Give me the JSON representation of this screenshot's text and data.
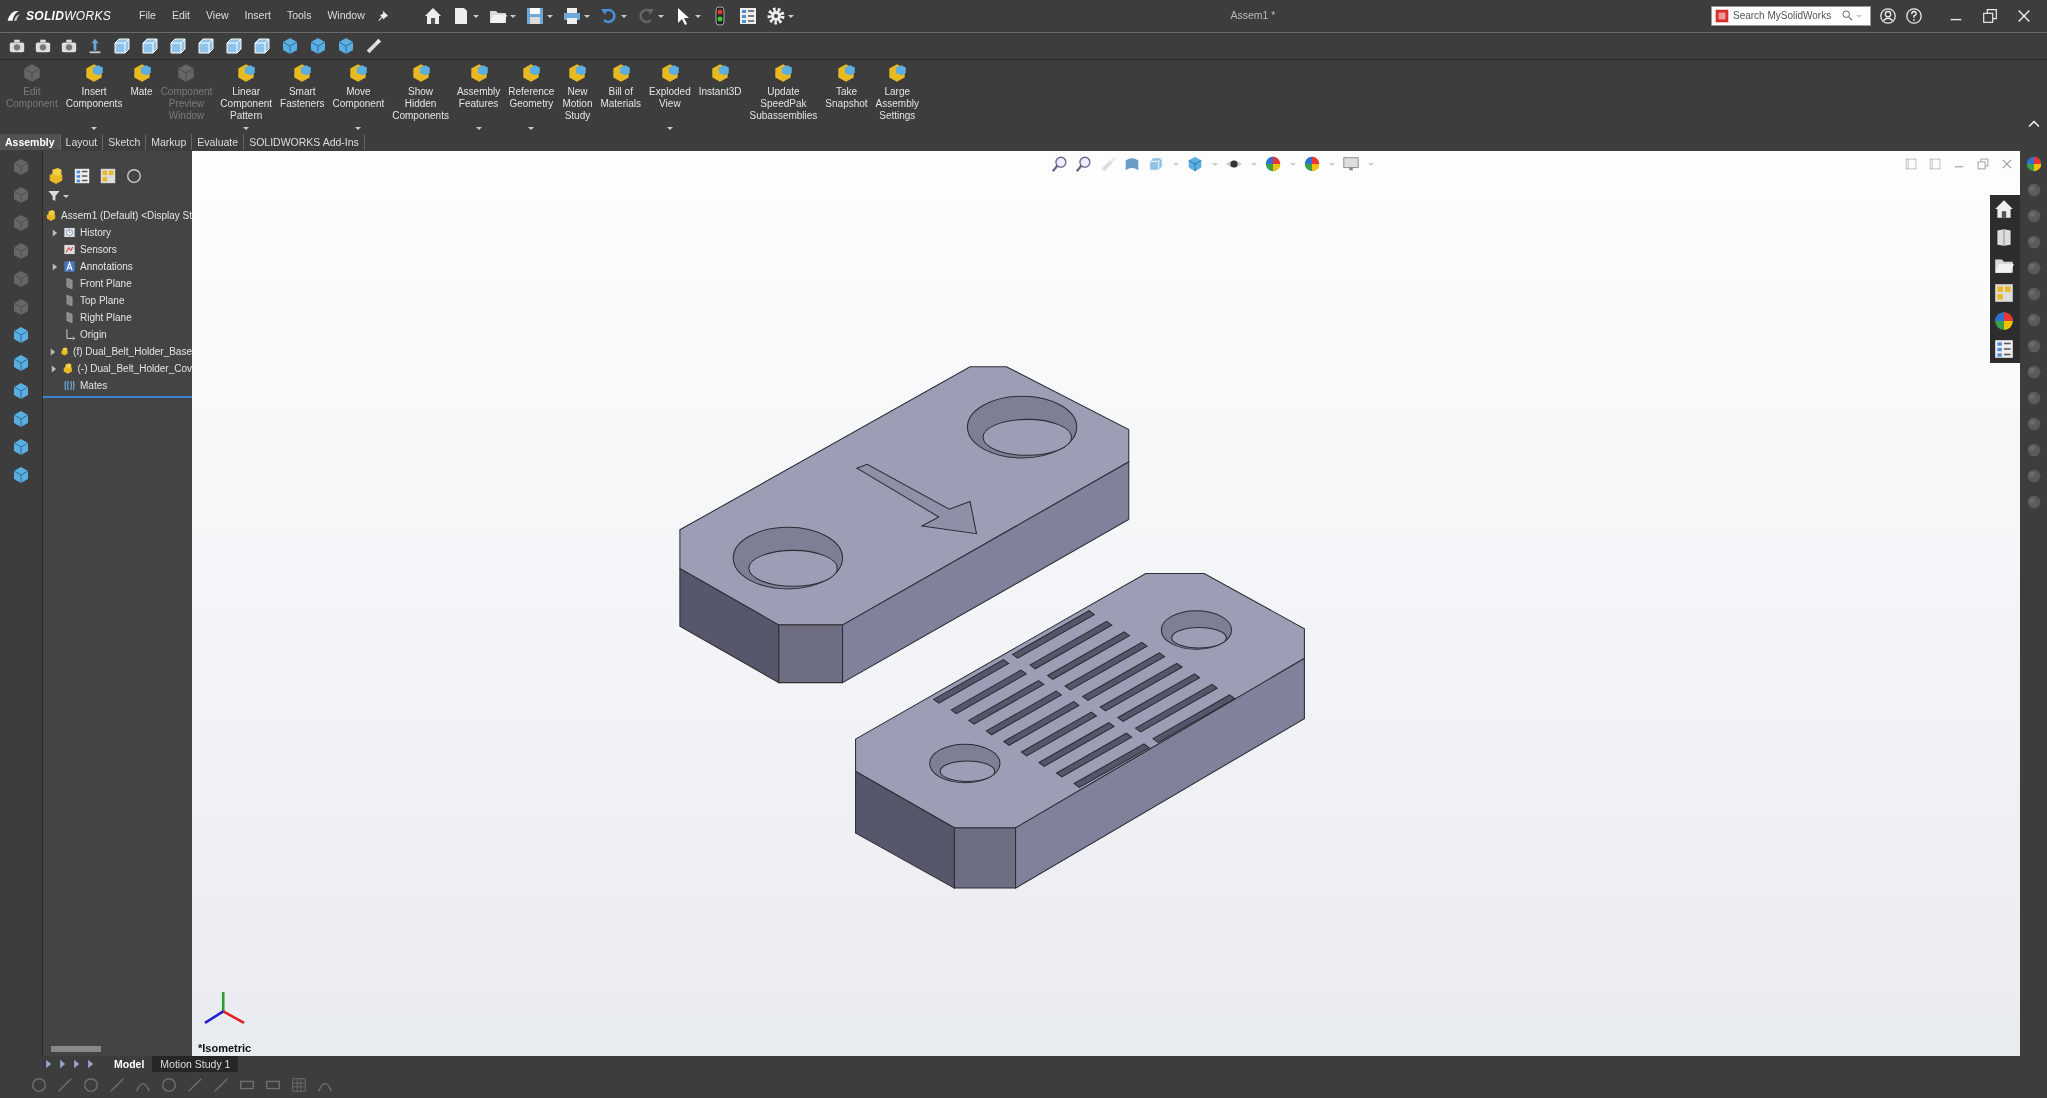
{
  "app": {
    "logo": "**SOLID**WORKS"
  },
  "menu": [
    "File",
    "Edit",
    "View",
    "Insert",
    "Tools",
    "Window"
  ],
  "title": "Assem1 *",
  "search": {
    "placeholder": "Search MySolidWorks"
  },
  "ribbon": [
    {
      "label": "Edit\nComponent",
      "disabled": true,
      "dropdown": false
    },
    {
      "label": "Insert\nComponents",
      "disabled": false,
      "dropdown": true
    },
    {
      "label": "Mate",
      "disabled": false,
      "dropdown": false
    },
    {
      "label": "Component\nPreview\nWindow",
      "disabled": true,
      "dropdown": false
    },
    {
      "label": "Linear\nComponent\nPattern",
      "disabled": false,
      "dropdown": true
    },
    {
      "label": "Smart\nFasteners",
      "disabled": false,
      "dropdown": false
    },
    {
      "label": "Move\nComponent",
      "disabled": false,
      "dropdown": true
    },
    {
      "label": "Show\nHidden\nComponents",
      "disabled": false,
      "dropdown": false
    },
    {
      "label": "Assembly\nFeatures",
      "disabled": false,
      "dropdown": true
    },
    {
      "label": "Reference\nGeometry",
      "disabled": false,
      "dropdown": true
    },
    {
      "label": "New\nMotion\nStudy",
      "disabled": false,
      "dropdown": false
    },
    {
      "label": "Bill of\nMaterials",
      "disabled": false,
      "dropdown": false
    },
    {
      "label": "Exploded\nView",
      "disabled": false,
      "dropdown": true
    },
    {
      "label": "Instant3D",
      "disabled": false,
      "dropdown": false
    },
    {
      "label": "Update\nSpeedPak\nSubassemblies",
      "disabled": false,
      "dropdown": false
    },
    {
      "label": "Take\nSnapshot",
      "disabled": false,
      "dropdown": false
    },
    {
      "label": "Large\nAssembly\nSettings",
      "disabled": false,
      "dropdown": false
    }
  ],
  "command_tabs": [
    {
      "label": "Assembly",
      "selected": true
    },
    {
      "label": "Layout",
      "selected": false
    },
    {
      "label": "Sketch",
      "selected": false
    },
    {
      "label": "Markup",
      "selected": false
    },
    {
      "label": "Evaluate",
      "selected": false
    },
    {
      "label": "SOLIDWORKS Add-Ins",
      "selected": false
    }
  ],
  "tree": {
    "items": [
      {
        "label": "Assem1 (Default) <Display St",
        "kind": "assembly",
        "children": [
          {
            "label": "History",
            "kind": "history",
            "collapsed": true
          },
          {
            "label": "Sensors",
            "kind": "sensors",
            "collapsed": false
          },
          {
            "label": "Annotations",
            "kind": "annotations",
            "collapsed": true
          },
          {
            "label": "Front Plane",
            "kind": "plane",
            "collapsed": false
          },
          {
            "label": "Top Plane",
            "kind": "plane",
            "collapsed": false
          },
          {
            "label": "Right Plane",
            "kind": "plane",
            "collapsed": false
          },
          {
            "label": "Origin",
            "kind": "origin",
            "collapsed": false
          },
          {
            "label": "(f) Dual_Belt_Holder_Base",
            "kind": "part",
            "collapsed": true
          },
          {
            "label": "(-) Dual_Belt_Holder_Cov",
            "kind": "part",
            "collapsed": true
          },
          {
            "label": "Mates",
            "kind": "mates",
            "collapsed": false
          }
        ]
      }
    ]
  },
  "view": {
    "orientation_label": "*Isometric"
  },
  "bottom_tabs": [
    {
      "label": "Model",
      "selected": true
    },
    {
      "label": "Motion Study 1",
      "selected": false
    }
  ]
}
